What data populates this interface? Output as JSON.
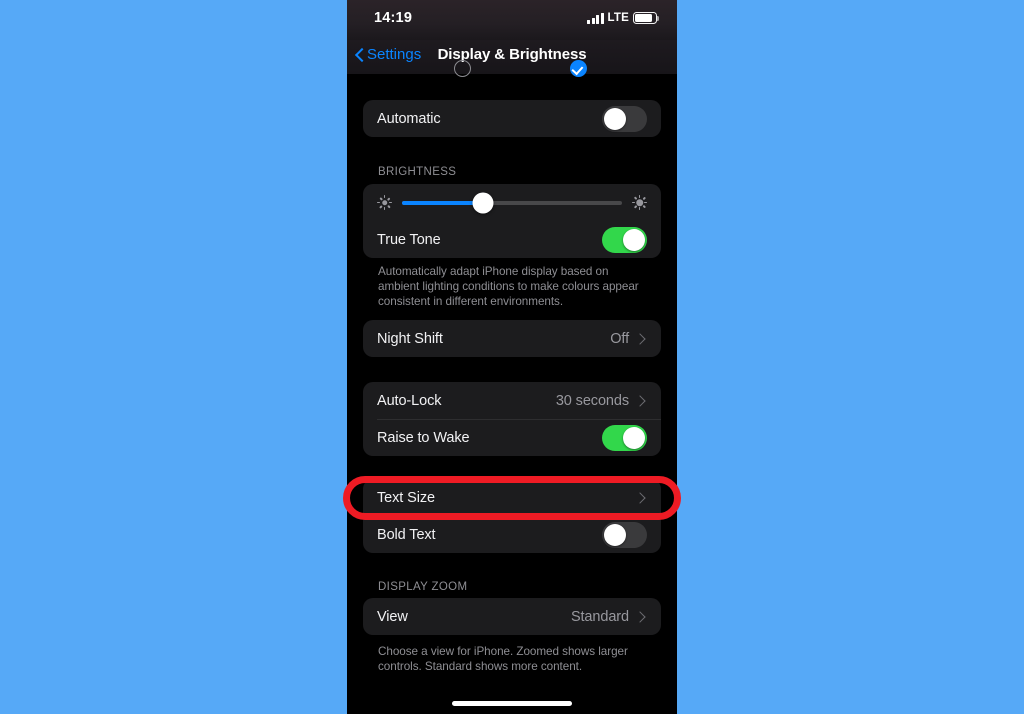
{
  "background_color": "#56a9f7",
  "status_bar": {
    "time": "14:19",
    "network_label": "LTE",
    "signal_icon": "signal-bars-icon",
    "battery_icon": "battery-icon"
  },
  "nav": {
    "back_label": "Settings",
    "back_icon": "chevron-left-icon",
    "title": "Display & Brightness"
  },
  "appearance": {
    "light_option_icon": "radio-unselected-icon",
    "dark_option_icon": "radio-checked-icon",
    "accent_color": "#0a84ff"
  },
  "groups": {
    "automatic": {
      "label": "Automatic",
      "toggle_state": "off"
    },
    "brightness": {
      "header": "BRIGHTNESS",
      "slider": {
        "value_percent": 37,
        "min_icon": "sun-small-icon",
        "max_icon": "sun-large-icon",
        "fill_color": "#0a84ff"
      },
      "true_tone": {
        "label": "True Tone",
        "toggle_state": "on"
      },
      "footnote": "Automatically adapt iPhone display based on ambient lighting conditions to make colours appear consistent in different environments."
    },
    "night_shift": {
      "label": "Night Shift",
      "value": "Off",
      "chevron_icon": "chevron-right-icon"
    },
    "lock": {
      "auto_lock": {
        "label": "Auto-Lock",
        "value": "30 seconds",
        "chevron_icon": "chevron-right-icon"
      },
      "raise_to_wake": {
        "label": "Raise to Wake",
        "toggle_state": "on"
      }
    },
    "text": {
      "text_size": {
        "label": "Text Size",
        "chevron_icon": "chevron-right-icon"
      },
      "bold_text": {
        "label": "Bold Text",
        "toggle_state": "off"
      }
    },
    "display_zoom": {
      "header": "DISPLAY ZOOM",
      "view": {
        "label": "View",
        "value": "Standard",
        "chevron_icon": "chevron-right-icon"
      },
      "footnote": "Choose a view for iPhone. Zoomed shows larger controls. Standard shows more content."
    }
  },
  "annotation": {
    "type": "highlight-rectangle",
    "color": "#ee1b24",
    "target": "Text Size"
  },
  "home_indicator_icon": "home-indicator"
}
